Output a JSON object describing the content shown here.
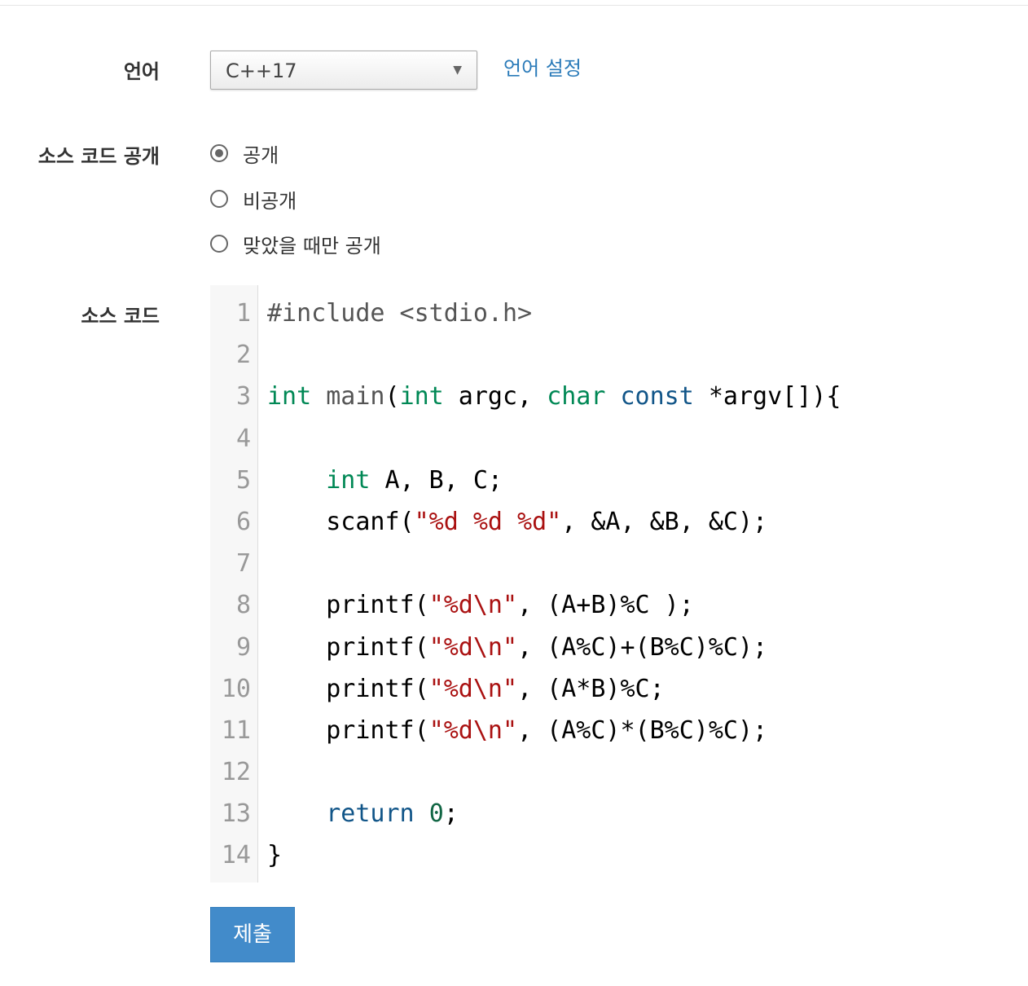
{
  "form": {
    "language_label": "언어",
    "language_value": "C++17",
    "language_settings_link": "언어 설정",
    "visibility_label": "소스 코드 공개",
    "visibility_options": [
      {
        "label": "공개",
        "checked": true
      },
      {
        "label": "비공개",
        "checked": false
      },
      {
        "label": "맞았을 때만 공개",
        "checked": false
      }
    ],
    "source_label": "소스 코드",
    "submit_label": "제출"
  },
  "editor": {
    "lines": [
      {
        "n": "1",
        "tokens": [
          [
            "meta",
            "#include <stdio.h>"
          ]
        ]
      },
      {
        "n": "2",
        "tokens": []
      },
      {
        "n": "3",
        "tokens": [
          [
            "kw",
            "int"
          ],
          [
            "",
            " "
          ],
          [
            "def",
            "main"
          ],
          [
            "",
            "("
          ],
          [
            "kw",
            "int"
          ],
          [
            "",
            " argc, "
          ],
          [
            "kw",
            "char"
          ],
          [
            "",
            " "
          ],
          [
            "kw2",
            "const"
          ],
          [
            "",
            " *argv[]){"
          ]
        ]
      },
      {
        "n": "4",
        "tokens": []
      },
      {
        "n": "5",
        "tokens": [
          [
            "",
            "    "
          ],
          [
            "kw",
            "int"
          ],
          [
            "",
            " A, B, C;"
          ]
        ]
      },
      {
        "n": "6",
        "tokens": [
          [
            "",
            "    scanf("
          ],
          [
            "str",
            "\"%d %d %d\""
          ],
          [
            "",
            ", &A, &B, &C);"
          ]
        ]
      },
      {
        "n": "7",
        "tokens": []
      },
      {
        "n": "8",
        "tokens": [
          [
            "",
            "    printf("
          ],
          [
            "str",
            "\"%d\\n\""
          ],
          [
            "",
            ", (A+B)%C );"
          ]
        ]
      },
      {
        "n": "9",
        "tokens": [
          [
            "",
            "    printf("
          ],
          [
            "str",
            "\"%d\\n\""
          ],
          [
            "",
            ", (A%C)+(B%C)%C);"
          ]
        ]
      },
      {
        "n": "10",
        "tokens": [
          [
            "",
            "    printf("
          ],
          [
            "str",
            "\"%d\\n\""
          ],
          [
            "",
            ", (A*B)%C;"
          ]
        ]
      },
      {
        "n": "11",
        "tokens": [
          [
            "",
            "    printf("
          ],
          [
            "str",
            "\"%d\\n\""
          ],
          [
            "",
            ", (A%C)*(B%C)%C);"
          ]
        ]
      },
      {
        "n": "12",
        "tokens": []
      },
      {
        "n": "13",
        "tokens": [
          [
            "",
            "    "
          ],
          [
            "kw2",
            "return"
          ],
          [
            "",
            " "
          ],
          [
            "num",
            "0"
          ],
          [
            "",
            ";"
          ]
        ]
      },
      {
        "n": "14",
        "tokens": [
          [
            "",
            "}"
          ]
        ]
      }
    ]
  }
}
